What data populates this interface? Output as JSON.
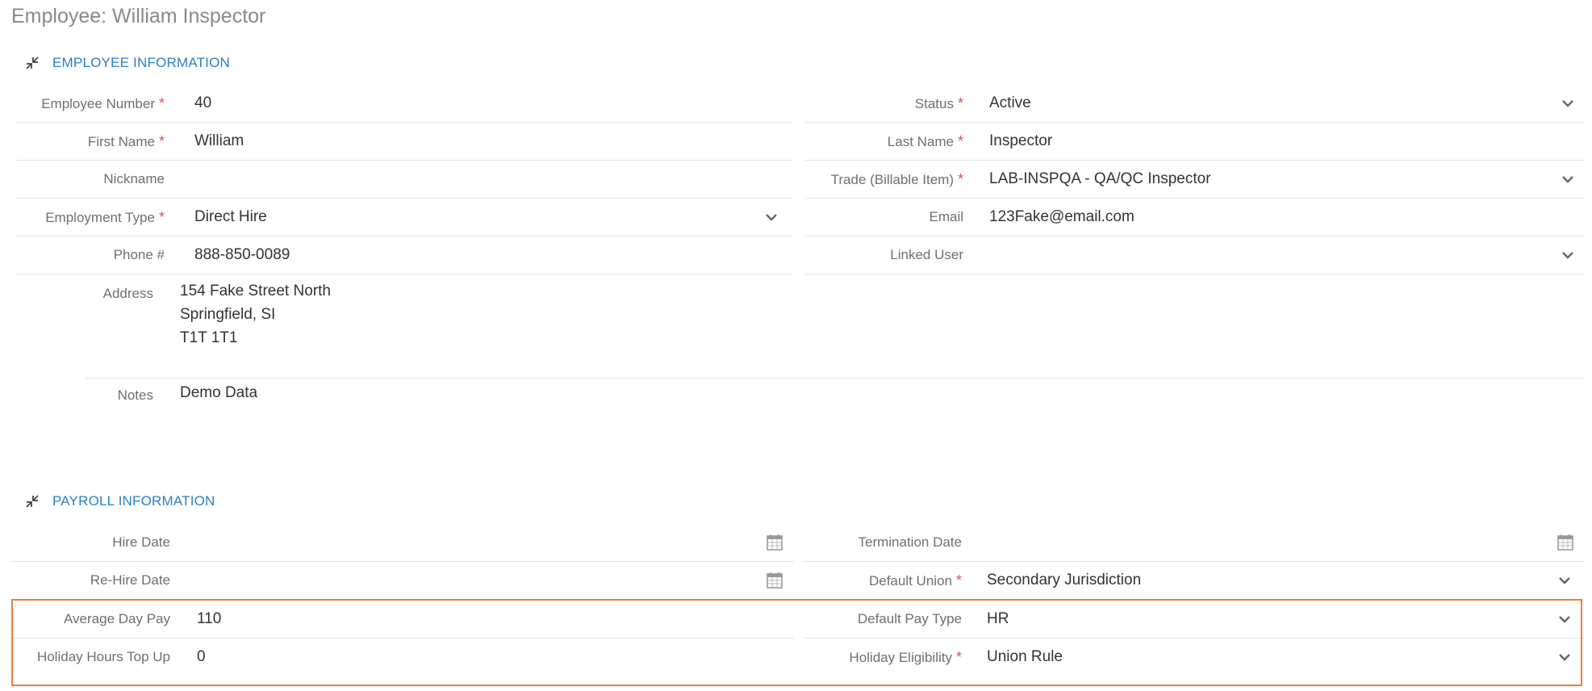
{
  "page": {
    "title": "Employee: William Inspector"
  },
  "employee_section": {
    "title": "EMPLOYEE INFORMATION",
    "fields": {
      "employee_number": {
        "label": "Employee Number",
        "required": "*",
        "value": "40"
      },
      "status": {
        "label": "Status",
        "required": "*",
        "value": "Active"
      },
      "first_name": {
        "label": "First Name",
        "required": "*",
        "value": "William"
      },
      "last_name": {
        "label": "Last Name",
        "required": "*",
        "value": "Inspector"
      },
      "nickname": {
        "label": "Nickname",
        "value": ""
      },
      "trade": {
        "label": "Trade (Billable Item)",
        "required": "*",
        "value": "LAB-INSPQA - QA/QC Inspector"
      },
      "employment_type": {
        "label": "Employment Type",
        "required": "*",
        "value": "Direct Hire"
      },
      "email": {
        "label": "Email",
        "value": "123Fake@email.com"
      },
      "phone": {
        "label": "Phone #",
        "value": "888-850-0089"
      },
      "linked_user": {
        "label": "Linked User",
        "value": ""
      },
      "address": {
        "label": "Address",
        "line1": "154 Fake Street North",
        "line2": "Springfield, SI",
        "line3": "T1T 1T1"
      },
      "notes": {
        "label": "Notes",
        "value": "Demo Data"
      }
    }
  },
  "payroll_section": {
    "title": "PAYROLL INFORMATION",
    "fields": {
      "hire_date": {
        "label": "Hire Date",
        "value": ""
      },
      "termination_date": {
        "label": "Termination Date",
        "value": ""
      },
      "rehire_date": {
        "label": "Re-Hire Date",
        "value": ""
      },
      "default_union": {
        "label": "Default Union",
        "required": "*",
        "value": "Secondary Jurisdiction"
      },
      "average_day_pay": {
        "label": "Average Day Pay",
        "value": "110"
      },
      "default_pay_type": {
        "label": "Default Pay Type",
        "value": "HR"
      },
      "holiday_hours_top_up": {
        "label": "Holiday Hours Top Up",
        "value": "0"
      },
      "holiday_eligibility": {
        "label": "Holiday Eligibility",
        "required": "*",
        "value": "Union Rule"
      }
    }
  },
  "icons": {
    "collapse": "collapse-arrows-icon",
    "dropdown": "chevron-down-icon",
    "calendar": "calendar-icon"
  },
  "colors": {
    "section_title": "#2b7fc3",
    "required": "#d9534f",
    "highlight_border": "#ef7d3b"
  }
}
